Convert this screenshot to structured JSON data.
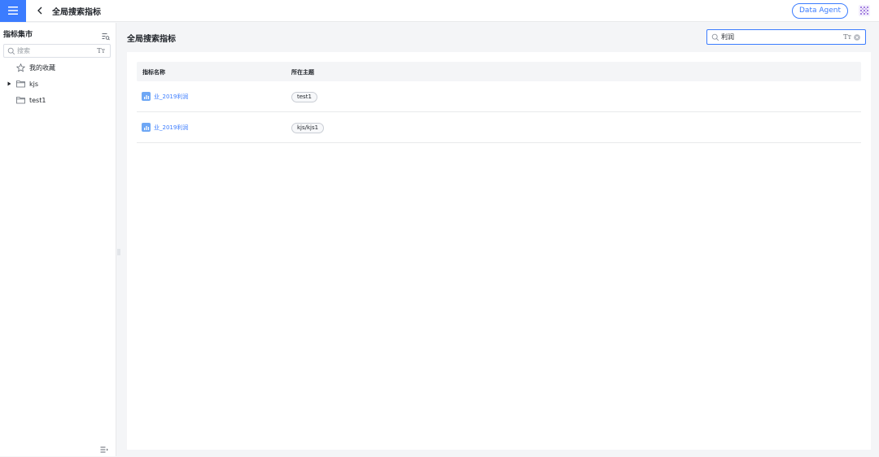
{
  "header": {
    "title": "全局搜索指标",
    "agent_button": "Data Agent",
    "menu_icon": "hamburger-icon",
    "back_icon": "chevron-left-icon",
    "apps_icon": "grid-apps-icon"
  },
  "sidebar": {
    "title": "指标集市",
    "search_placeholder": "搜索",
    "case_icon_label": "Tт",
    "items": [
      {
        "label": "我的收藏",
        "icon": "star-icon"
      },
      {
        "label": "kjs",
        "icon": "folder-icon",
        "expandable": true
      },
      {
        "label": "test1",
        "icon": "folder-icon"
      }
    ]
  },
  "main": {
    "title": "全局搜索指标",
    "search_value": "利润",
    "case_icon_label": "Tт",
    "columns": [
      "指标名称",
      "所在主题"
    ],
    "rows": [
      {
        "name": "业_2019利润",
        "topic": "test1"
      },
      {
        "name": "业_2019利润",
        "topic": "kjs/kjs1"
      }
    ]
  },
  "colors": {
    "accent": "#3b7cff",
    "background": "#f4f5f7",
    "panel": "#ffffff",
    "metric_icon": "#6ea7f5"
  }
}
